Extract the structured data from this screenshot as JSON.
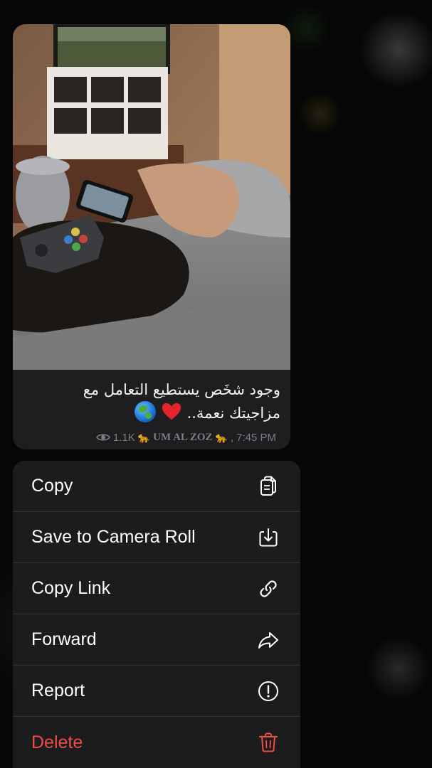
{
  "message": {
    "caption_line1": "وجود شخَص يستطيع التعامل مع",
    "caption_line2": "مزاجيتك نعمة..",
    "views": "1.1K",
    "channel_name": "UM AL ZOZ",
    "channel_separator": ",",
    "time": "7:45 PM",
    "emoji": [
      "red-heart",
      "globe-asia-australia"
    ],
    "decorations": [
      "leopard-emoji",
      "leopard-emoji"
    ]
  },
  "context_menu": {
    "items": [
      {
        "label": "Copy",
        "icon": "copy-icon",
        "destructive": false
      },
      {
        "label": "Save to Camera Roll",
        "icon": "save-download-icon",
        "destructive": false
      },
      {
        "label": "Copy Link",
        "icon": "link-icon",
        "destructive": false
      },
      {
        "label": "Forward",
        "icon": "forward-arrow-icon",
        "destructive": false
      },
      {
        "label": "Report",
        "icon": "report-exclamation-icon",
        "destructive": false
      },
      {
        "label": "Delete",
        "icon": "trash-icon",
        "destructive": true
      }
    ]
  },
  "colors": {
    "background": "#050505",
    "bubble": "#1e1e21",
    "menu": "#1c1c1e",
    "separator": "#313134",
    "text": "#ffffff",
    "meta_text": "#7d7d82",
    "destructive": "#ec4d45"
  }
}
